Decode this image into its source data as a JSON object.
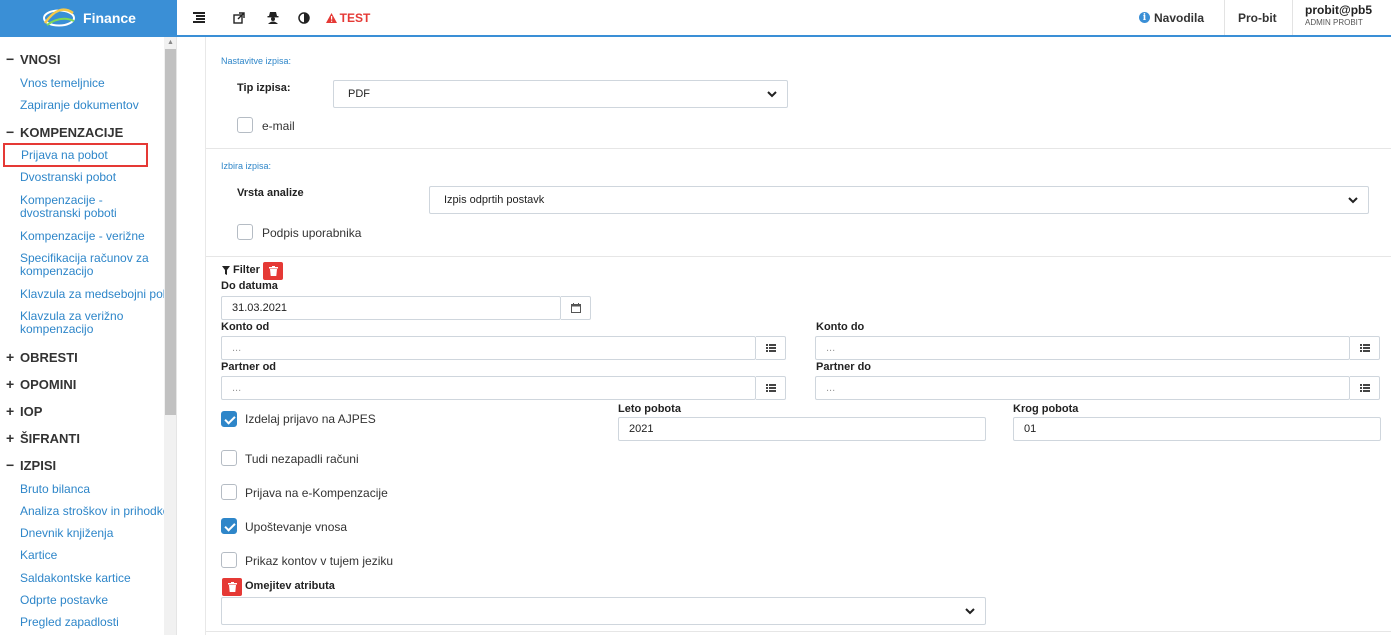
{
  "app": {
    "brand": "Finance",
    "test_label": "TEST",
    "help_label": "Navodila",
    "company_label": "Pro-bit",
    "user_name": "probit@pb5",
    "user_role": "ADMIN PROBIT",
    "accent_color": "#3a8fd6",
    "danger_color": "#e53935"
  },
  "sidebar": {
    "sections": {
      "vnosi": "VNOSI",
      "kompenzacije": "KOMPENZACIJE",
      "obresti": "OBRESTI",
      "opomini": "OPOMINI",
      "iop": "IOP",
      "sifranti": "ŠIFRANTI",
      "izpisi": "IZPISI"
    },
    "items": {
      "vnos_temeljnice": "Vnos temeljnice",
      "zapiranje_dokumentov": "Zapiranje dokumentov",
      "prijava_na_pobot": "Prijava na pobot",
      "dvostranski_pobot": "Dvostranski pobot",
      "kompenzacije_dvostranski": "Kompenzacije - dvostranski poboti",
      "kompenzacije_verizne": "Kompenzacije - verižne",
      "specifikacija": "Specifikacija računov za kompenzacijo",
      "klavzula_medsebojni": "Klavzula za medsebojni pobot",
      "klavzula_verizno": "Klavzula za verižno kompenzacijo",
      "bruto_bilanca": "Bruto bilanca",
      "analiza_stroskov": "Analiza stroškov in prihodkov",
      "dnevnik_knjizenja": "Dnevnik knjiženja",
      "kartice": "Kartice",
      "saldakontske_kartice": "Saldakontske kartice",
      "odprte_postavke": "Odprte postavke",
      "pregled_zapadlosti": "Pregled zapadlosti"
    }
  },
  "settings": {
    "section_title": "Nastavitve izpisa:",
    "tip_label": "Tip izpisa:",
    "tip_value": "PDF",
    "email_label": "e-mail",
    "email_checked": false
  },
  "choice": {
    "section_title": "Izbira izpisa:",
    "vrsta_label": "Vrsta analize",
    "vrsta_value": "Izpis odprtih postavk",
    "podpis_label": "Podpis uporabnika",
    "podpis_checked": false
  },
  "filter": {
    "title": "Filter",
    "do_datuma_label": "Do datuma",
    "do_datuma_value": "31.03.2021",
    "konto_od_label": "Konto od",
    "konto_od_placeholder": "...",
    "konto_do_label": "Konto do",
    "konto_do_placeholder": "...",
    "partner_od_label": "Partner od",
    "partner_od_placeholder": "...",
    "partner_do_label": "Partner do",
    "partner_do_placeholder": "...",
    "ajpes_label": "Izdelaj prijavo na AJPES",
    "ajpes_checked": true,
    "leto_label": "Leto pobota",
    "leto_value": "2021",
    "krog_label": "Krog pobota",
    "krog_value": "01",
    "nezapadli_label": "Tudi nezapadli računi",
    "nezapadli_checked": false,
    "ekomp_label": "Prijava na e-Kompenzacije",
    "ekomp_checked": false,
    "upostevanje_label": "Upoštevanje vnosa",
    "upostevanje_checked": true,
    "tuji_label": "Prikaz kontov v tujem jeziku",
    "tuji_checked": false,
    "atribut_label": "Omejitev atributa",
    "atribut_value": ""
  }
}
